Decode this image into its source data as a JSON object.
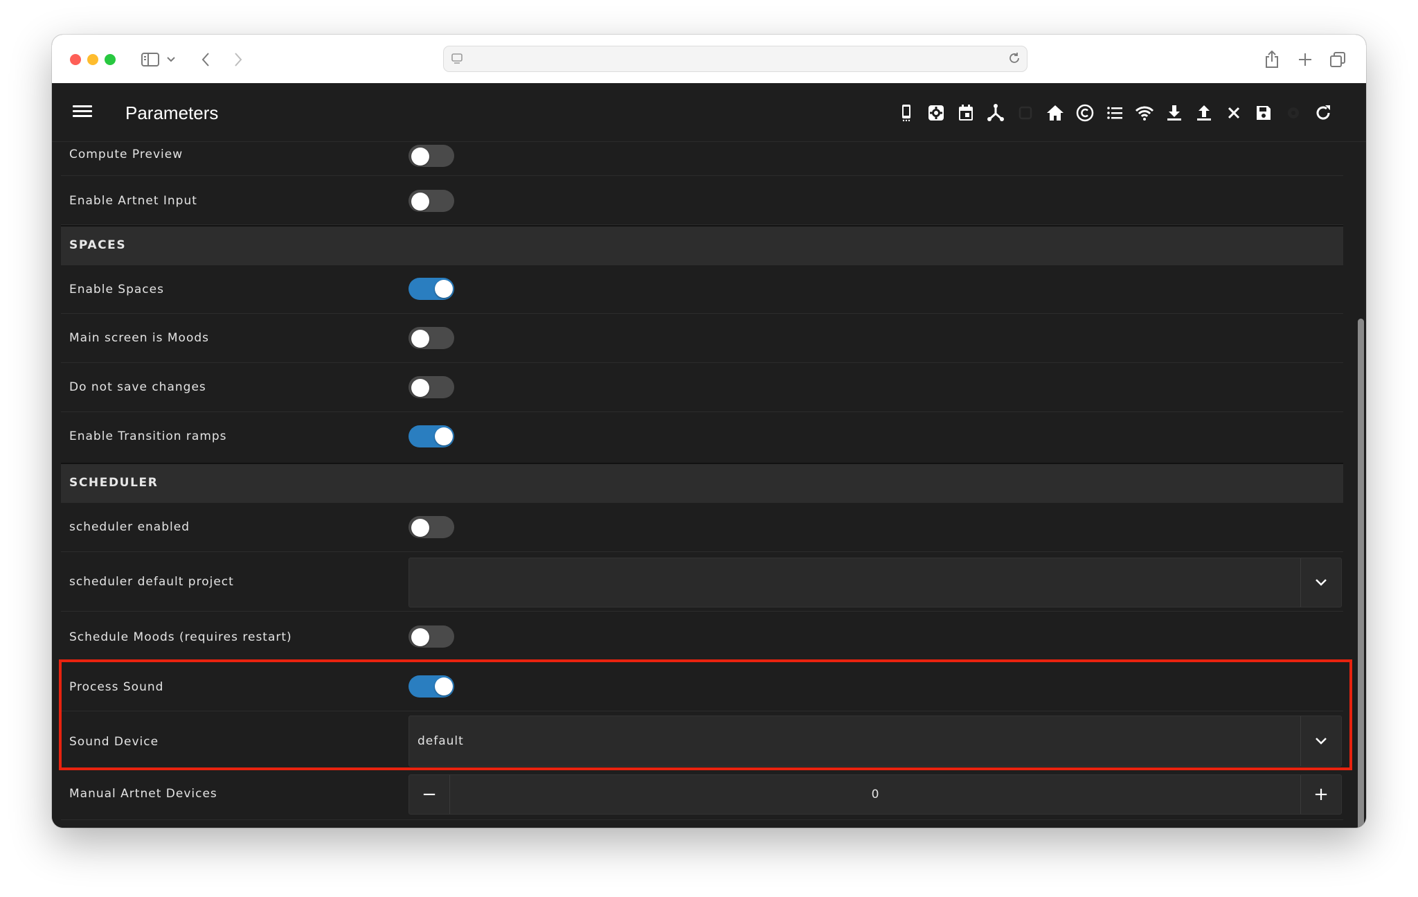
{
  "browser": {
    "url_value": "",
    "url_placeholder": ""
  },
  "app": {
    "title": "Parameters",
    "toolbar_icons": [
      "phone-icon",
      "settings-icon",
      "calendar-icon",
      "network-icon",
      "disabled-icon",
      "home-icon",
      "copyright-icon",
      "list-icon",
      "wifi-icon",
      "download-icon",
      "upload-icon",
      "close-icon",
      "save-icon",
      "disabled-gear-icon",
      "refresh-icon"
    ]
  },
  "rows": {
    "compute_preview": "Compute Preview",
    "enable_artnet_input": "Enable Artnet Input",
    "spaces_header": "SPACES",
    "enable_spaces": "Enable Spaces",
    "main_screen_moods": "Main screen is Moods",
    "do_not_save": "Do not save changes",
    "enable_transition_ramps": "Enable Transition ramps",
    "scheduler_header": "SCHEDULER",
    "scheduler_enabled": "scheduler enabled",
    "scheduler_default_project": "scheduler default project",
    "scheduler_default_project_value": "",
    "schedule_moods": "Schedule Moods (requires restart)",
    "process_sound": "Process Sound",
    "sound_device": "Sound Device",
    "sound_device_value": "default",
    "manual_artnet_devices": "Manual Artnet Devices",
    "manual_artnet_devices_value": "0"
  },
  "toggles": {
    "compute_preview": false,
    "enable_artnet_input": false,
    "enable_spaces": true,
    "main_screen_moods": false,
    "do_not_save": false,
    "enable_transition_ramps": true,
    "scheduler_enabled": false,
    "schedule_moods": false,
    "process_sound": true
  },
  "colors": {
    "accent": "#2a7ec0",
    "highlight": "#e8230f",
    "background": "#1e1e1e"
  }
}
